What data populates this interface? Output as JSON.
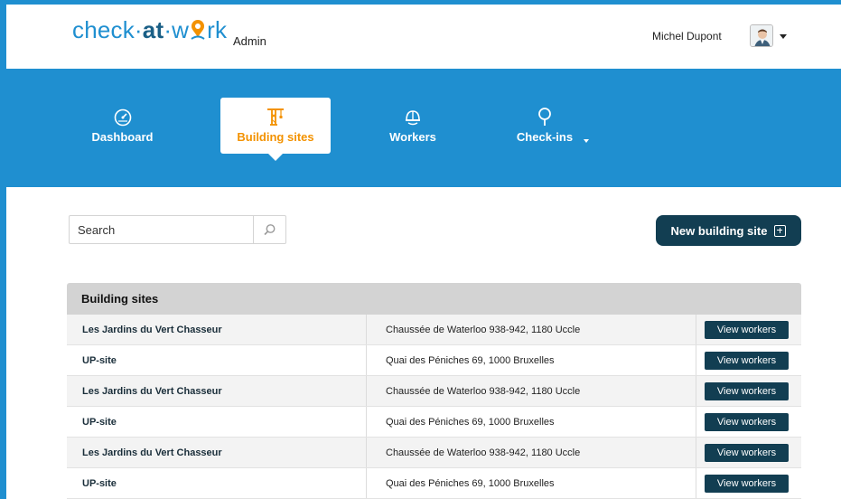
{
  "header": {
    "logo": {
      "part1": "check",
      "sep1": "·",
      "part2": "at",
      "sep2": "·",
      "part3a": "w",
      "part3b": "rk"
    },
    "admin_label": "Admin",
    "user_name": "Michel Dupont"
  },
  "nav": {
    "items": [
      {
        "label": "Dashboard",
        "icon": "speedometer-icon"
      },
      {
        "label": "Building sites",
        "icon": "crane-icon",
        "active": true
      },
      {
        "label": "Workers",
        "icon": "helmet-icon"
      },
      {
        "label": "Check-ins",
        "icon": "map-pin-icon"
      }
    ]
  },
  "search": {
    "placeholder": "Search",
    "value": ""
  },
  "actions": {
    "new_label": "New building site"
  },
  "table": {
    "title": "Building sites",
    "rows": [
      {
        "name": "Les Jardins du Vert Chasseur",
        "address": "Chaussée de Waterloo 938-942, 1180 Uccle",
        "action": "View workers"
      },
      {
        "name": "UP-site",
        "address": "Quai des Péniches 69, 1000 Bruxelles",
        "action": "View workers"
      },
      {
        "name": "Les Jardins du Vert Chasseur",
        "address": "Chaussée de Waterloo 938-942, 1180 Uccle",
        "action": "View workers"
      },
      {
        "name": "UP-site",
        "address": "Quai des Péniches 69, 1000 Bruxelles",
        "action": "View workers"
      },
      {
        "name": "Les Jardins du Vert Chasseur",
        "address": "Chaussée de Waterloo 938-942, 1180 Uccle",
        "action": "View workers"
      },
      {
        "name": "UP-site",
        "address": "Quai des Péniches 69, 1000 Bruxelles",
        "action": "View workers"
      }
    ]
  },
  "colors": {
    "brand_blue": "#1f8fd0",
    "dark_navy": "#123e52",
    "accent_orange": "#f39200"
  }
}
